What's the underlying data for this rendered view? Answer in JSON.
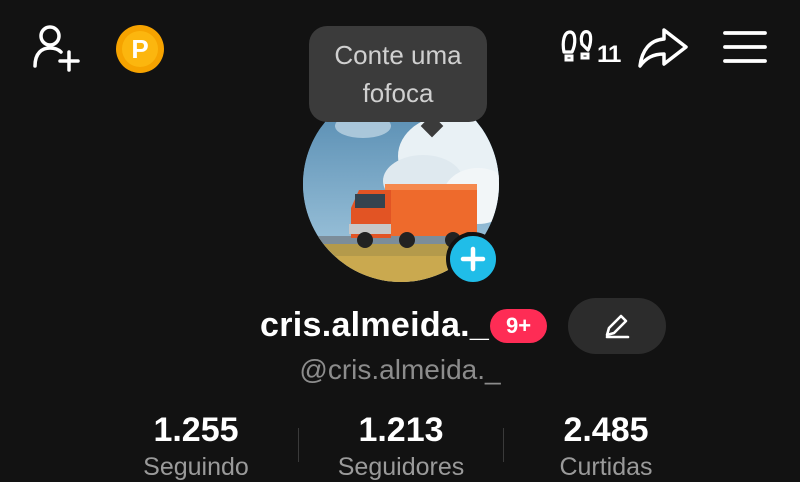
{
  "topbar": {
    "add_friend_icon": "person-plus-icon",
    "coin_label": "P",
    "coin_color": "#f6a300",
    "history_icon": "footprints-icon",
    "history_count": "11",
    "share_icon": "share-arrow-icon",
    "menu_icon": "hamburger-menu-icon"
  },
  "tooltip": {
    "text": "Conte uma fofoca"
  },
  "profile": {
    "avatar_icon": "truck-photo",
    "username": "cris.almeida._",
    "badge": "9+",
    "badge_color": "#fe2c55",
    "edit_icon": "pencil-icon",
    "handle": "@cris.almeida._"
  },
  "stats": [
    {
      "value": "1.255",
      "label": "Seguindo"
    },
    {
      "value": "1.213",
      "label": "Seguidores"
    },
    {
      "value": "2.485",
      "label": "Curtidas"
    }
  ],
  "colors": {
    "background": "#121212",
    "accent": "#20bde8"
  }
}
